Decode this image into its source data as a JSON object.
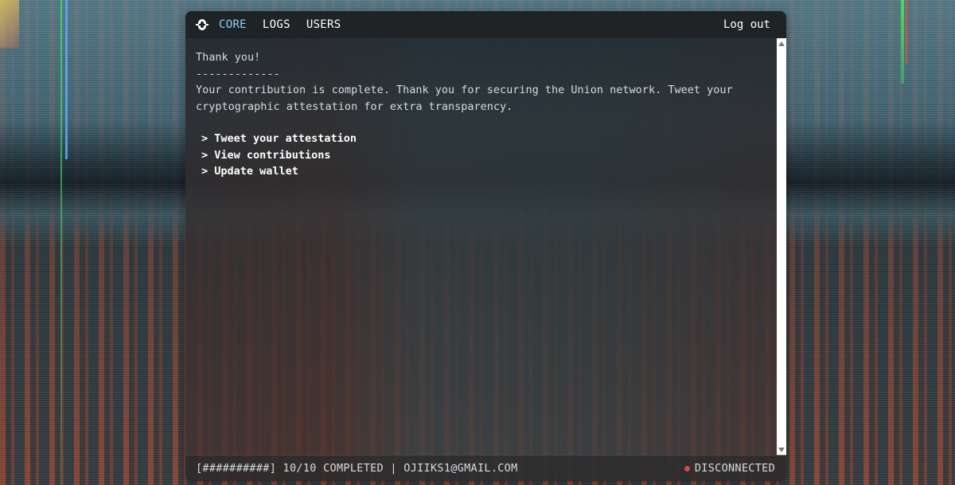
{
  "header": {
    "logo_icon": "union-logo-icon",
    "nav": [
      {
        "label": "CORE",
        "active": true
      },
      {
        "label": "LOGS",
        "active": false
      },
      {
        "label": "USERS",
        "active": false
      }
    ],
    "logout_label": "Log out"
  },
  "content": {
    "title": "Thank you!",
    "divider": "-------------",
    "message": "Your contribution is complete. Thank you for securing the Union network. Tweet your cryptographic attestation for extra transparency.",
    "menu": [
      "> Tweet your attestation",
      "> View contributions",
      "> Update wallet"
    ]
  },
  "footer": {
    "progress": "[##########] 10/10 COMPLETED | OJIIKS1@GMAIL.COM",
    "status": "DISCONNECTED",
    "status_color": "#e04444"
  },
  "colors": {
    "active_nav": "#8fd3f4",
    "header_bg": "#1f2326"
  }
}
